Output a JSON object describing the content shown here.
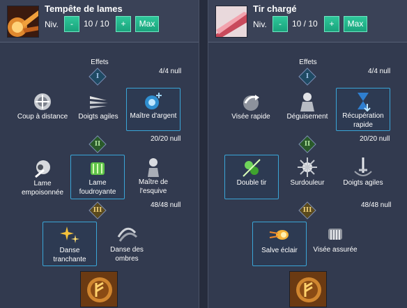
{
  "left": {
    "title": "Tempête de lames",
    "niv_label": "Niv.",
    "minus": "-",
    "level": "10 / 10",
    "plus": "+",
    "max": "Max",
    "effects_label": "Effets",
    "tier1_numeral": "I",
    "tier2_numeral": "II",
    "tier3_numeral": "III",
    "tier1_count": "4/4 null",
    "tier2_count": "20/20 null",
    "tier3_count": "48/48 null",
    "tier1": [
      "Coup à distance",
      "Doigts agiles",
      "Maître d'argent"
    ],
    "tier2": [
      "Lame empoisonnée",
      "Lame foudroyante",
      "Maître de l'esquive"
    ],
    "tier3": [
      "Danse tranchante",
      "Danse des ombres"
    ]
  },
  "right": {
    "title": "Tir chargé",
    "niv_label": "Niv.",
    "minus": "-",
    "level": "10 / 10",
    "plus": "+",
    "max": "Max",
    "effects_label": "Effets",
    "tier1_numeral": "I",
    "tier2_numeral": "II",
    "tier3_numeral": "III",
    "tier1_count": "4/4 null",
    "tier2_count": "20/20 null",
    "tier3_count": "48/48 null",
    "tier1": [
      "Visée rapide",
      "Déguisement",
      "Récupération rapide"
    ],
    "tier2": [
      "Double tir",
      "Surdouleur",
      "Doigts agiles"
    ],
    "tier3": [
      "Salve éclair",
      "Visée assurée"
    ]
  }
}
